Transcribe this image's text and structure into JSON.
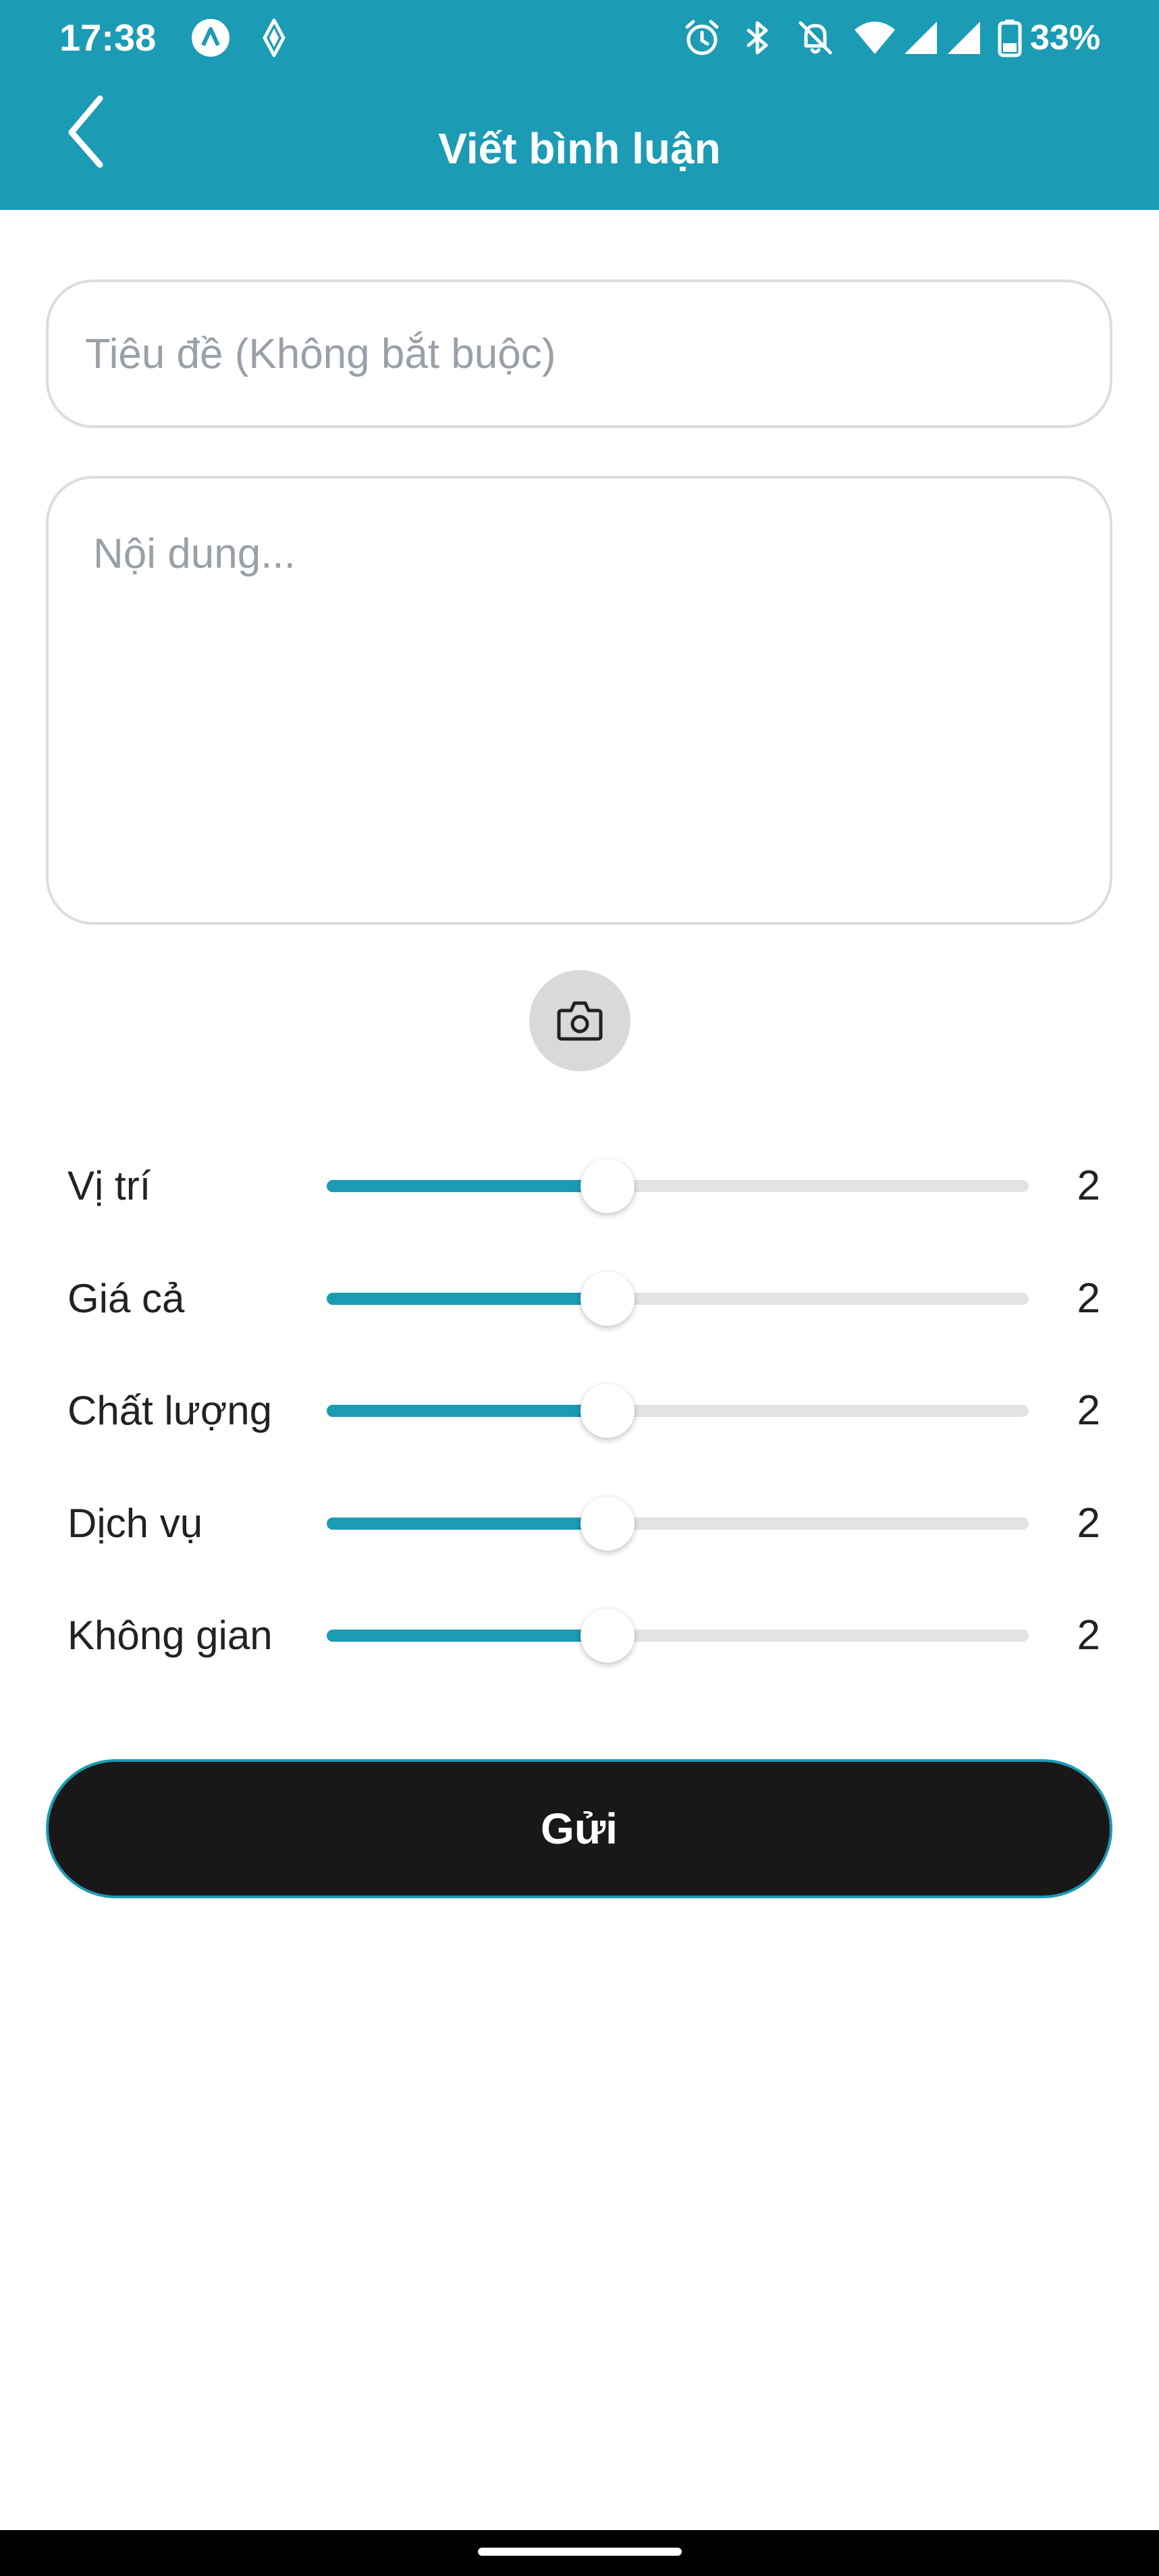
{
  "colors": {
    "primary": "#1b9bb4",
    "submit_background": "#181818",
    "track": "#e3e3e3",
    "photo_button_background": "#d9d9d9"
  },
  "status_bar": {
    "time": "17:38",
    "battery": "33%",
    "icons": [
      "app-a-icon",
      "app-diamond-icon",
      "alarm-icon",
      "bluetooth-icon",
      "notifications-off-icon",
      "wifi-icon",
      "signal-icon",
      "signal-icon",
      "battery-icon"
    ]
  },
  "header": {
    "title": "Viết bình luận",
    "back_icon": "chevron-left-icon"
  },
  "form": {
    "title_placeholder": "Tiêu đề (Không bắt buộc)",
    "title_value": "",
    "content_placeholder": "Nội dung...",
    "content_value": "",
    "photo_button_icon": "camera-icon"
  },
  "ratings": [
    {
      "label": "Vị trí",
      "value": "2",
      "fill_fraction": 0.4
    },
    {
      "label": "Giá cả",
      "value": "2",
      "fill_fraction": 0.4
    },
    {
      "label": "Chất lượng",
      "value": "2",
      "fill_fraction": 0.4
    },
    {
      "label": "Dịch vụ",
      "value": "2",
      "fill_fraction": 0.4
    },
    {
      "label": "Không gian",
      "value": "2",
      "fill_fraction": 0.4
    }
  ],
  "submit": {
    "label": "Gửi"
  }
}
